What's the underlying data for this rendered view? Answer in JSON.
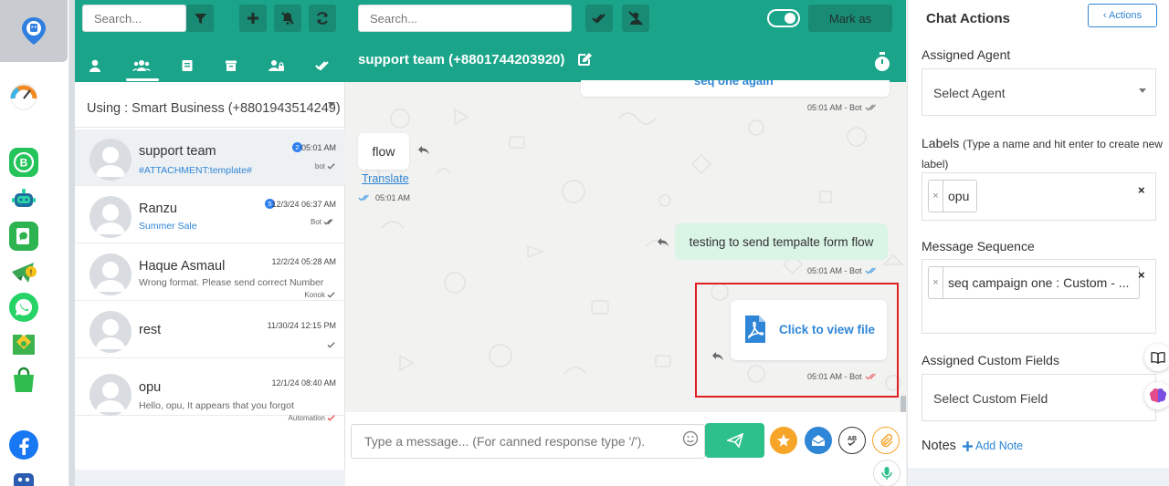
{
  "colors": {
    "primary": "#1aa58a",
    "accent": "#2f86d6",
    "highlight": "#e02020"
  },
  "convlist": {
    "search_placeholder": "Search...",
    "using_label": "Using : Smart Business (+8801943514249)",
    "tabs": [
      "user-icon",
      "users-icon",
      "book-icon",
      "archive-icon",
      "user-lock-icon",
      "check-double-icon"
    ],
    "items": [
      {
        "name": "support team",
        "sub": "#ATTACHMENT:template#",
        "time": "05:01 AM",
        "badge": "2",
        "meta": "bot",
        "read": "read"
      },
      {
        "name": "Ranzu",
        "sub": "Summer Sale",
        "time": "12/3/24 06:37 AM",
        "badge": "5",
        "meta": "Bot",
        "read": "read"
      },
      {
        "name": "Haque Asmaul",
        "sub": "Wrong format. Please send correct Number",
        "time": "12/2/24 05:28 AM",
        "badge": "",
        "meta": "Konok",
        "read": "sent"
      },
      {
        "name": "rest",
        "sub": "",
        "time": "11/30/24 12:15 PM",
        "badge": "",
        "meta": "",
        "read": "sent"
      },
      {
        "name": "opu",
        "sub": "Hello, opu, It appears that you forgot",
        "time": "12/1/24 08:40 AM",
        "badge": "",
        "meta": "Automation",
        "read": "error"
      }
    ]
  },
  "chat": {
    "search_placeholder": "Search...",
    "mark_as": "Mark as",
    "title": "support team (+8801744203920)",
    "top_partial_text": "seq one again",
    "top_partial_time": "05:01 AM - Bot",
    "flow_text": "flow",
    "translate": "Translate",
    "flow_time": "05:01 AM",
    "out_text": "testing to send tempalte form flow",
    "out_time": "05:01 AM - Bot",
    "file_text": "Click to view file",
    "file_time": "05:01 AM - Bot",
    "composer_placeholder": "Type a message... (For canned response type '/')."
  },
  "actions": {
    "title": "Chat Actions",
    "actions_btn": "‹ Actions",
    "assigned_agent_label": "Assigned Agent",
    "select_agent": "Select Agent",
    "labels_label": "Labels",
    "labels_hint": "(Type a name and hit enter to create new label)",
    "label_tags": [
      "opu"
    ],
    "sequence_label": "Message Sequence",
    "sequence_tags": [
      "seq campaign one : Custom - ..."
    ],
    "custom_fields_label": "Assigned Custom Fields",
    "select_custom_field": "Select Custom Field",
    "notes_label": "Notes",
    "add_note": "Add Note"
  }
}
